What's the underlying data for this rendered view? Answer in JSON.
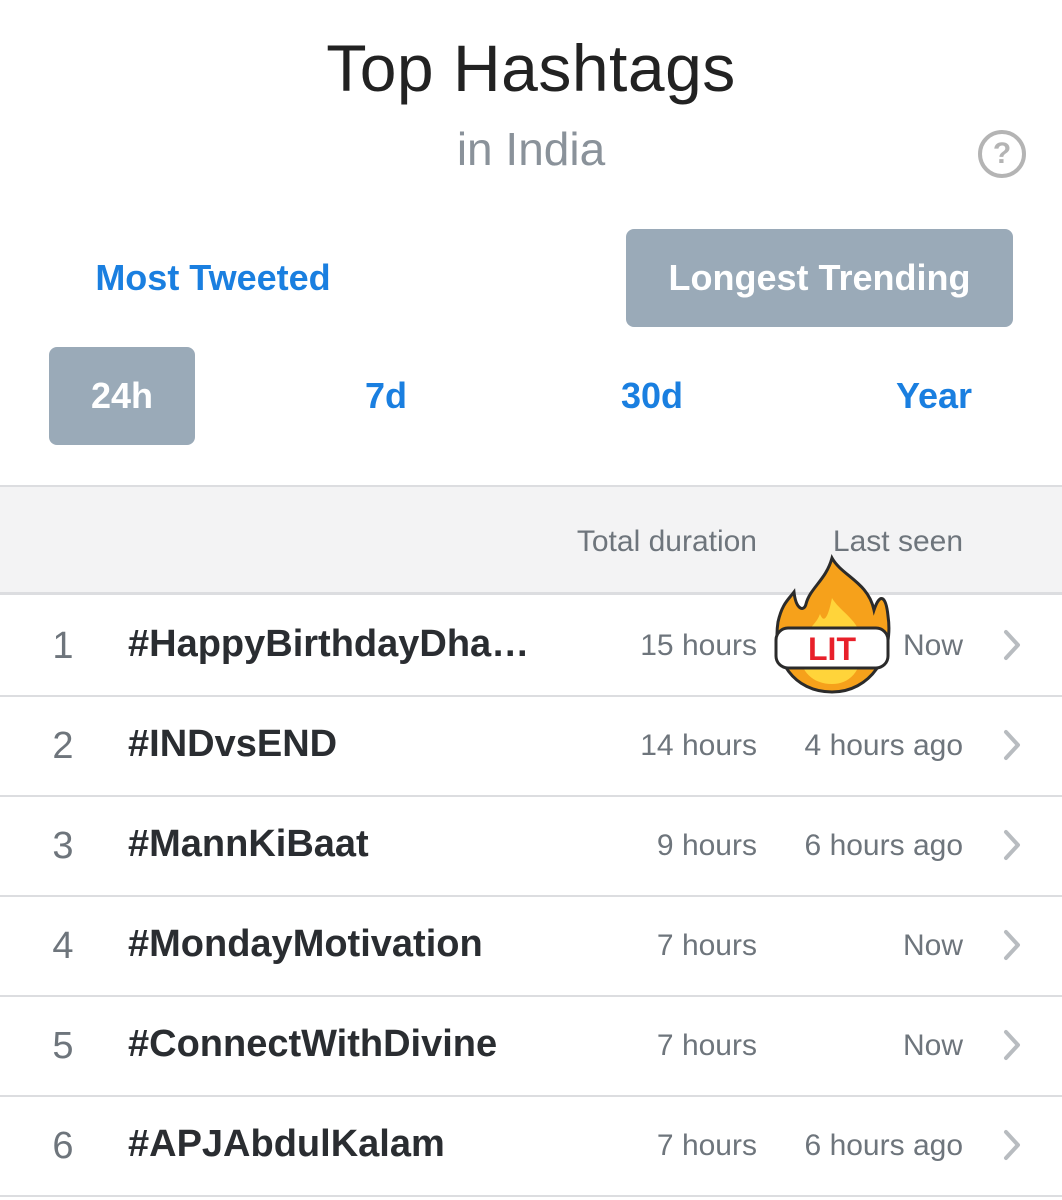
{
  "header": {
    "title": "Top Hashtags",
    "subtitle": "in India",
    "help_label": "?"
  },
  "mode_toggle": {
    "most_tweeted": "Most Tweeted",
    "longest_trending": "Longest Trending",
    "selected": "Longest Trending"
  },
  "time_ranges": {
    "items": [
      "24h",
      "7d",
      "30d",
      "Year"
    ],
    "selected": "24h"
  },
  "table": {
    "columns": {
      "total_duration": "Total duration",
      "last_seen": "Last seen"
    },
    "rows": [
      {
        "rank": "1",
        "hashtag": "#HappyBirthdayDhan…",
        "duration": "15 hours",
        "last_seen": "Now"
      },
      {
        "rank": "2",
        "hashtag": "#INDvsEND",
        "duration": "14 hours",
        "last_seen": "4 hours ago"
      },
      {
        "rank": "3",
        "hashtag": "#MannKiBaat",
        "duration": "9 hours",
        "last_seen": "6 hours ago"
      },
      {
        "rank": "4",
        "hashtag": "#MondayMotivation",
        "duration": "7 hours",
        "last_seen": "Now"
      },
      {
        "rank": "5",
        "hashtag": "#ConnectWithDivine",
        "duration": "7 hours",
        "last_seen": "Now"
      },
      {
        "rank": "6",
        "hashtag": "#APJAbdulKalam",
        "duration": "7 hours",
        "last_seen": "6 hours ago"
      }
    ]
  },
  "sticker": {
    "label": "LIT",
    "icon": "fire-icon"
  },
  "colors": {
    "accent": "#1a7fe0",
    "selected_bg": "#9aaab8",
    "header_bg": "#f3f3f4"
  }
}
